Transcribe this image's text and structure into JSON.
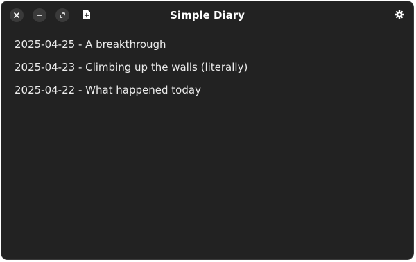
{
  "window": {
    "title": "Simple Diary"
  },
  "titlebar": {
    "buttons": {
      "close_icon": "close-icon",
      "minimize_icon": "minimize-icon",
      "maximize_icon": "maximize-icon",
      "new_entry_icon": "new-document-icon",
      "settings_icon": "gear-icon"
    }
  },
  "entries": [
    {
      "label": "2025-04-25 - A breakthrough"
    },
    {
      "label": "2025-04-23 - Climbing up the walls (literally)"
    },
    {
      "label": "2025-04-22 - What happened today"
    }
  ],
  "colors": {
    "window_bg": "#222222",
    "text": "#ececec",
    "button_bg": "#3a3a3a"
  }
}
